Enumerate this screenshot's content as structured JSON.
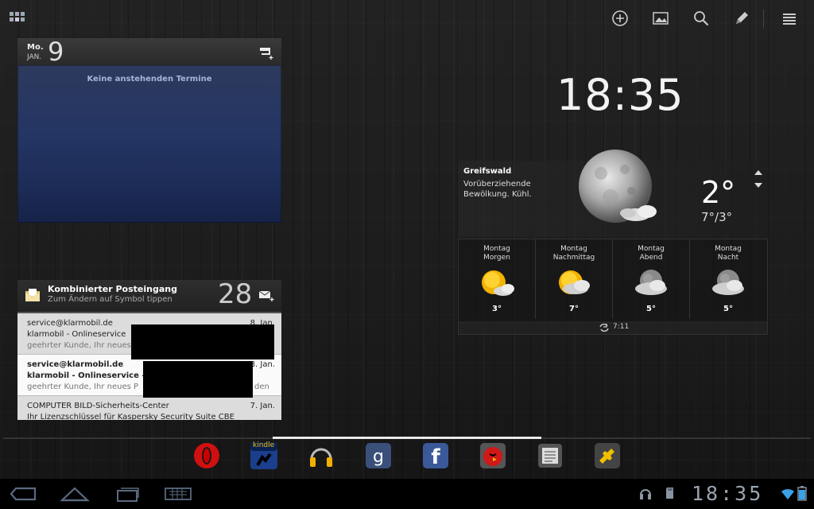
{
  "top_bar": {
    "icons": [
      "apps-grid-icon",
      "add-icon",
      "wallpaper-icon",
      "search-icon",
      "edit-icon",
      "menu-icon"
    ]
  },
  "calendar": {
    "day_name": "Mo.",
    "month": "JAN.",
    "date": "9",
    "empty_text": "Keine anstehenden Termine"
  },
  "email": {
    "title": "Kombinierter Posteingang",
    "subtitle": "Zum Ändern auf Symbol tippen",
    "count": "28",
    "messages": [
      {
        "from": "service@klarmobil.de",
        "subject": "klarmobil - Onlineservice",
        "preview": "geehrter Kunde, Ihr neues",
        "date": "8. Jan.",
        "unread": false
      },
      {
        "from": "service@klarmobil.de",
        "subject": "klarmobil - Onlineservice -",
        "preview": "geehrter Kunde, Ihr neues P",
        "preview_tail": "den",
        "date": "8. Jan.",
        "unread": true
      },
      {
        "from": "COMPUTER BILD-Sicherheits-Center",
        "subject": "Ihr Lizenzschlüssel für Kaspersky Security Suite CBE",
        "preview": "",
        "date": "7. Jan.",
        "unread": false
      }
    ]
  },
  "clock": {
    "time": "18:35"
  },
  "weather": {
    "city": "Greifswald",
    "condition": "Vorüberziehende Bewölkung. Kühl.",
    "temp": "2°",
    "range": "7°/3°",
    "forecast": [
      {
        "day": "Montag",
        "period": "Morgen",
        "temp": "3°",
        "icon": "sun-cloud-icon"
      },
      {
        "day": "Montag",
        "period": "Nachmittag",
        "temp": "7°",
        "icon": "sun-cloud-icon"
      },
      {
        "day": "Montag",
        "period": "Abend",
        "temp": "5°",
        "icon": "moon-cloud-icon"
      },
      {
        "day": "Montag",
        "period": "Nacht",
        "temp": "5°",
        "icon": "moon-cloud-icon"
      }
    ],
    "updated": "7:11"
  },
  "dock": {
    "apps": [
      "opera-icon",
      "kindle-icon",
      "headphones-music-icon",
      "google-search-icon",
      "facebook-icon",
      "angry-birds-icon",
      "news-icon",
      "puzzle-icon"
    ],
    "kindle_label": "kindle"
  },
  "system_bar": {
    "time": "18:35",
    "icons": [
      "back-icon",
      "home-icon",
      "recent-apps-icon",
      "keyboard-icon",
      "headphones-status-icon",
      "sd-card-icon",
      "wifi-icon",
      "battery-icon"
    ]
  }
}
